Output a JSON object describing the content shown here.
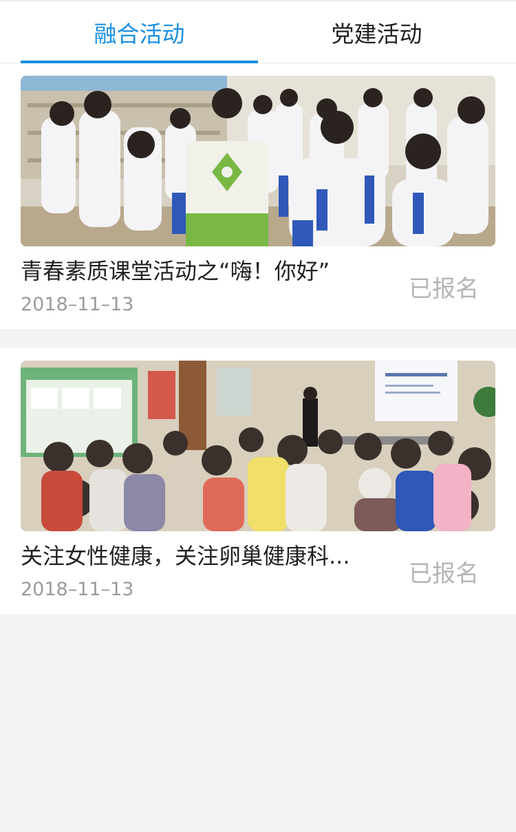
{
  "tabs": [
    {
      "label": "融合活动",
      "active": true
    },
    {
      "label": "党建活动",
      "active": false
    }
  ],
  "accent_color": "#1a8fe3",
  "activities": [
    {
      "title": "青春素质课堂活动之“嗨！你好”",
      "date": "2018–11–13",
      "status": "已报名",
      "photo": "students-in-uniform-activity-photo"
    },
    {
      "title": "关注女性健康，关注卵巢健康科...",
      "date": "2018–11–13",
      "status": "已报名",
      "photo": "health-lecture-audience-photo"
    }
  ]
}
